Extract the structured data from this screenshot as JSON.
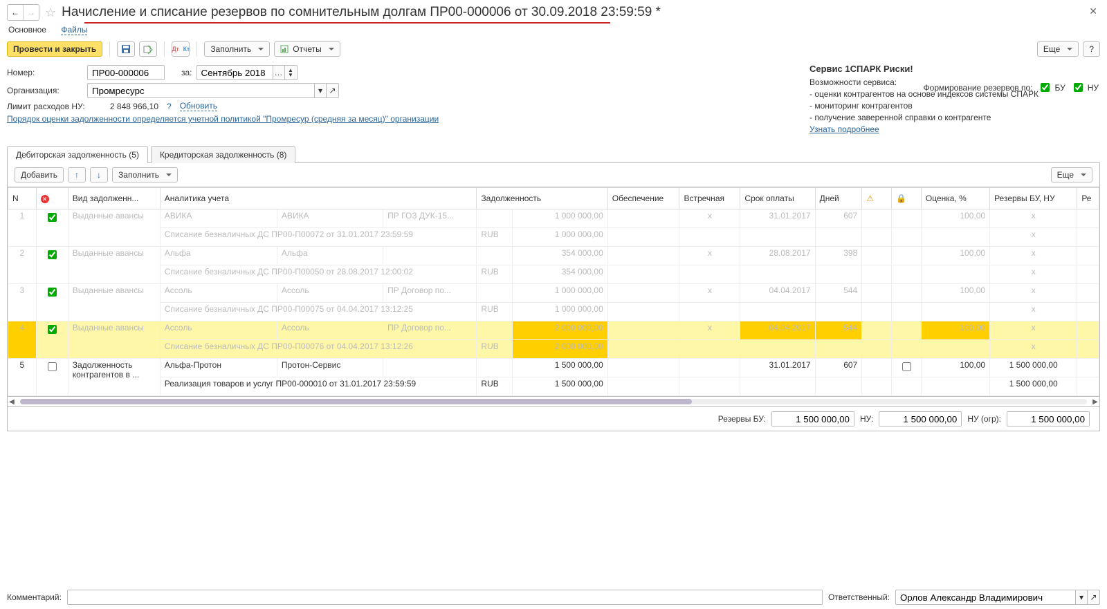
{
  "header": {
    "title": "Начисление и списание резервов по сомнительным долгам ПР00-000006 от 30.09.2018 23:59:59 *"
  },
  "topTabs": {
    "main": "Основное",
    "files": "Файлы"
  },
  "toolbar": {
    "postClose": "Провести и закрыть",
    "fill": "Заполнить",
    "reports": "Отчеты",
    "more": "Еще",
    "help": "?"
  },
  "form": {
    "numberLbl": "Номер:",
    "numberVal": "ПР00-000006",
    "periodLbl": "за:",
    "periodVal": "Сентябрь 2018",
    "orgLbl": "Организация:",
    "orgVal": "Промресурс",
    "limitLbl": "Лимит расходов НУ:",
    "limitVal": "2 848 966,10",
    "limitQ": "?",
    "limitRefresh": "Обновить",
    "policy": "Порядок оценки задолженности определяется учетной политикой \"Промресур (средняя за месяц)\" организации",
    "reserveBy": "Формирование резервов по:",
    "bu": "БУ",
    "nu": "НУ"
  },
  "spark": {
    "title": "Сервис 1СПАРК Риски!",
    "sub": "Возможности сервиса:",
    "l1": "- оценки контрагентов на основе индексов системы СПАРК",
    "l2": "- мониторинг контрагентов",
    "l3": "- получение заверенной справки о контрагенте",
    "more": "Узнать подробнее"
  },
  "subtabs": {
    "deb": "Дебиторская задолженность (5)",
    "cred": "Кредиторская задолженность (8)"
  },
  "subtoolbar": {
    "add": "Добавить",
    "fill": "Заполнить",
    "more": "Еще"
  },
  "columns": {
    "n": "N",
    "del": "",
    "type": "Вид задолженн...",
    "analytics": "Аналитика учета",
    "debt": "Задолженность",
    "secure": "Обеспечение",
    "counter": "Встречная",
    "due": "Срок оплаты",
    "days": "Дней",
    "warn": "",
    "lock": "",
    "rate": "Оценка, %",
    "reserve": "Резервы БУ, НУ",
    "res2": "Ре"
  },
  "rows": [
    {
      "n": "1",
      "chk": true,
      "type": "Выданные авансы",
      "a1": "АВИКА",
      "a2": "АВИКА",
      "a3": "ПР ГОЗ ДУК-15...",
      "debt1": "1 000 000,00",
      "doc": "Списание безналичных ДС ПР00-П00072 от 31.01.2017 23:59:59",
      "cur": "RUB",
      "debt2": "1 000 000,00",
      "counter": "x",
      "due": "31.01.2017",
      "days": "607",
      "rate": "100,00",
      "res": "x",
      "res2": "x"
    },
    {
      "n": "2",
      "chk": true,
      "type": "Выданные авансы",
      "a1": "Альфа",
      "a2": "Альфа",
      "a3": "",
      "debt1": "354 000,00",
      "doc": "Списание безналичных ДС ПР00-П00050 от 28.08.2017 12:00:02",
      "cur": "RUB",
      "debt2": "354 000,00",
      "counter": "x",
      "due": "28.08.2017",
      "days": "398",
      "rate": "100,00",
      "res": "x",
      "res2": "x"
    },
    {
      "n": "3",
      "chk": true,
      "type": "Выданные авансы",
      "a1": "Ассоль",
      "a2": "Ассоль",
      "a3": "ПР Договор по...",
      "debt1": "1 000 000,00",
      "doc": "Списание безналичных ДС ПР00-П00075 от 04.04.2017 13:12:25",
      "cur": "RUB",
      "debt2": "1 000 000,00",
      "counter": "x",
      "due": "04.04.2017",
      "days": "544",
      "rate": "100,00",
      "res": "x",
      "res2": "x"
    },
    {
      "n": "4",
      "chk": true,
      "type": "Выданные авансы",
      "a1": "Ассоль",
      "a2": "Ассоль",
      "a3": "ПР Договор по...",
      "debt1": "2 000 000,00",
      "doc": "Списание безналичных ДС ПР00-П00076 от 04.04.2017 13:12:26",
      "cur": "RUB",
      "debt2": "2 000 000,00",
      "counter": "x",
      "due": "04.04.2017",
      "days": "544",
      "rate": "100,00",
      "res": "x",
      "res2": "x",
      "sel": true
    },
    {
      "n": "5",
      "chk": false,
      "type": "Задолженность контрагентов в ...",
      "a1": "Альфа-Протон",
      "a2": "Протон-Сервис",
      "a3": "",
      "debt1": "1 500 000,00",
      "doc": "Реализация товаров и услуг ПР00-000010 от 31.01.2017 23:59:59",
      "cur": "RUB",
      "debt2": "1 500 000,00",
      "counter": "",
      "due": "31.01.2017",
      "days": "607",
      "rate": "100,00",
      "res": "1 500 000,00",
      "res2": "1 500 000,00",
      "active": true,
      "lockbox": true
    }
  ],
  "totals": {
    "buLbl": "Резервы БУ:",
    "bu": "1 500 000,00",
    "nuLbl": "НУ:",
    "nu": "1 500 000,00",
    "nuLimLbl": "НУ (огр):",
    "nuLim": "1 500 000,00"
  },
  "footer": {
    "commentLbl": "Комментарий:",
    "comment": "",
    "respLbl": "Ответственный:",
    "resp": "Орлов Александр Владимирович"
  }
}
